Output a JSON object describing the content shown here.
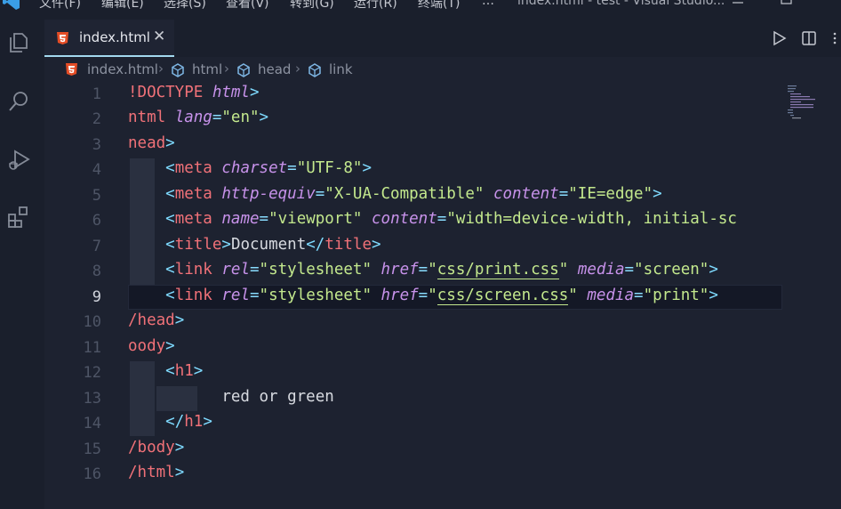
{
  "menu": {
    "items": [
      "文件(F)",
      "编辑(E)",
      "选择(S)",
      "查看(V)",
      "转到(G)",
      "运行(R)",
      "终端(T)",
      "…"
    ]
  },
  "window": {
    "title": "index.html - test - Visual Studio..."
  },
  "tab": {
    "label": "index.html",
    "close": "✕"
  },
  "breadcrumb": {
    "items": [
      "index.html",
      "html",
      "head",
      "link"
    ]
  },
  "editor": {
    "active_line": 9,
    "line_numbers": [
      "1",
      "2",
      "3",
      "4",
      "5",
      "6",
      "7",
      "8",
      "9",
      "10",
      "11",
      "12",
      "13",
      "14",
      "15",
      "16"
    ]
  },
  "colors": {
    "tag": "#f07178",
    "bracket": "#7fdbff",
    "attribute": "#c792ea",
    "string": "#c3e88d",
    "accent": "#a3d9ef"
  },
  "icons": [
    "vscode-logo-icon",
    "minimize-icon",
    "maximize-icon",
    "explorer-icon",
    "search-icon",
    "run-debug-icon",
    "extensions-icon",
    "html5-icon",
    "run-icon",
    "split-editor-icon"
  ]
}
